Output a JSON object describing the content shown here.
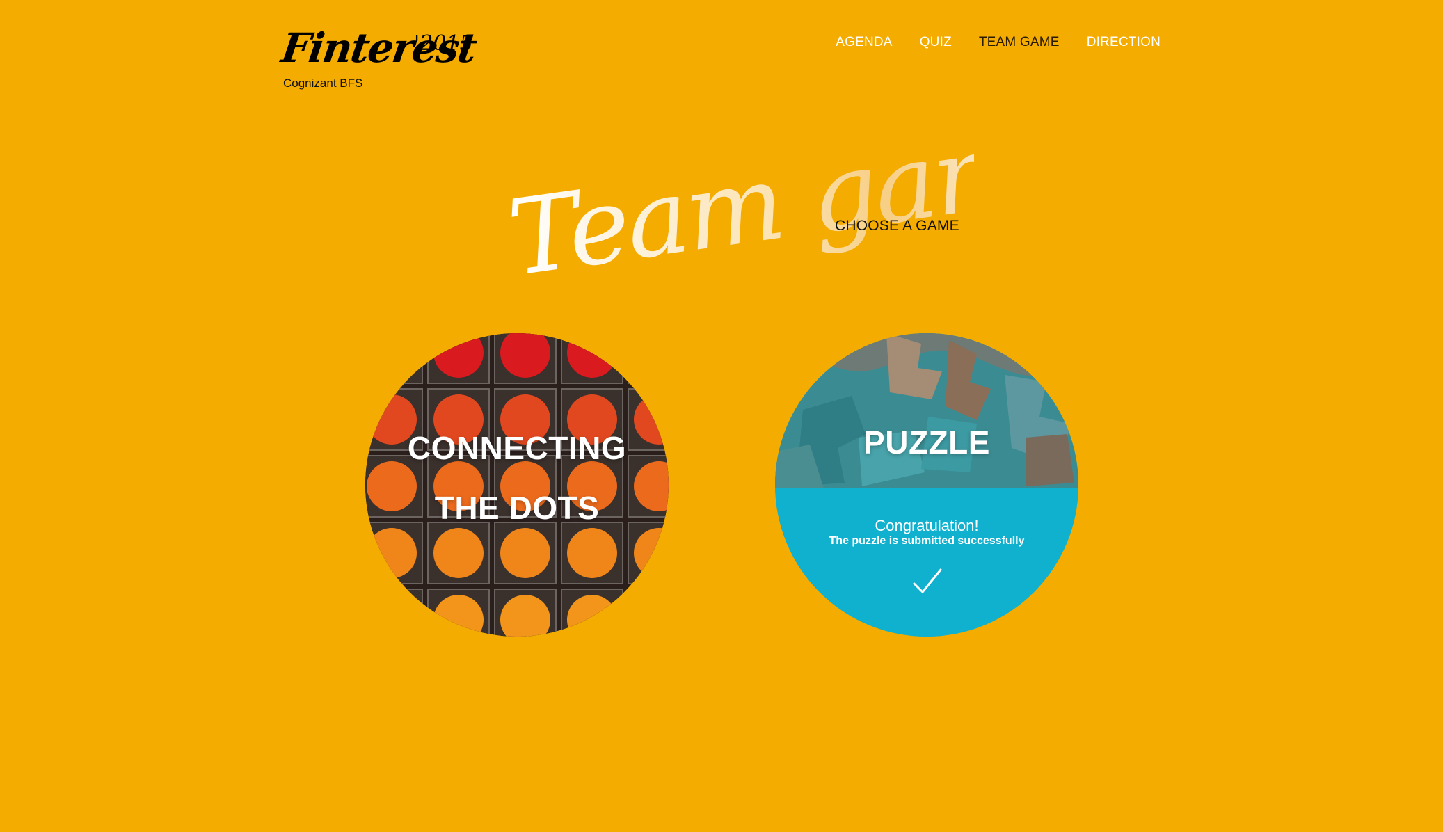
{
  "logo": {
    "word": "Finterest",
    "year": "'2015",
    "subtitle": "Cognizant BFS"
  },
  "nav": {
    "items": [
      {
        "label": "AGENDA",
        "active": false
      },
      {
        "label": "QUIZ",
        "active": false
      },
      {
        "label": "TEAM GAME",
        "active": true
      },
      {
        "label": "DIRECTION",
        "active": false
      }
    ]
  },
  "hero": {
    "title": "Team game",
    "subtitle": "CHOOSE A GAME"
  },
  "games": {
    "dots": {
      "line1": "CONNECTING",
      "line2": "THE DOTS",
      "icon": "orange-dots-grid-image"
    },
    "puzzle": {
      "title": "PUZZLE",
      "status_title": "Congratulation!",
      "status_message": "The puzzle is submitted successfully",
      "status_icon": "checkmark-icon",
      "image_icon": "puzzle-pieces-image"
    }
  },
  "colors": {
    "background": "#f4ac00",
    "success_panel": "#10b1cf",
    "nav_active": "#2a1a00",
    "nav_default": "#ffffff"
  }
}
